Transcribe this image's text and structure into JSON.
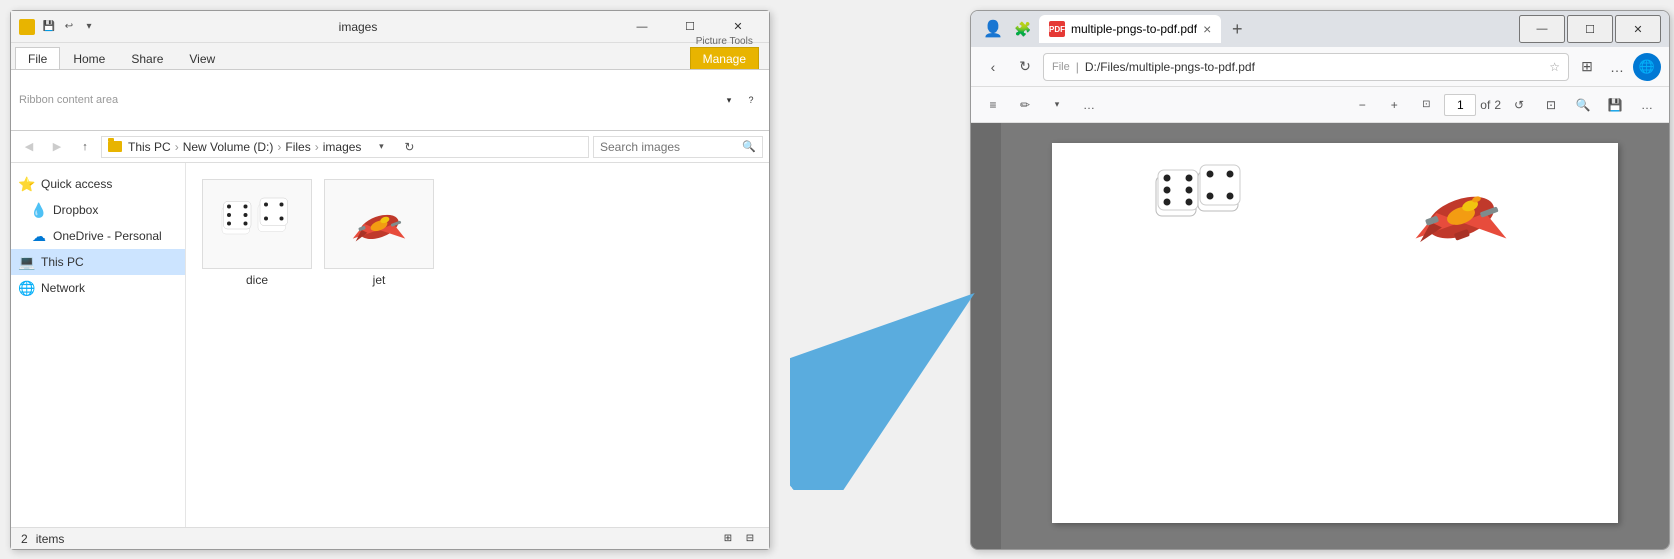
{
  "explorer": {
    "title": "images",
    "title_bar": {
      "app_icon": "folder",
      "qat": [
        "save",
        "undo",
        "dropdown"
      ],
      "window_controls": [
        "minimize",
        "maximize",
        "close"
      ]
    },
    "ribbon": {
      "tabs": [
        "File",
        "Home",
        "Share",
        "View",
        "Manage"
      ],
      "active_tab": "Manage",
      "picture_tools_label": "Picture Tools"
    },
    "address_bar": {
      "nav_back": "◀",
      "nav_forward": "▶",
      "nav_up": "↑",
      "path": "This PC › New Volume (D:) › Files › images",
      "search_placeholder": "Search images",
      "search_icon": "🔍",
      "refresh_icon": "↻",
      "dropdown_icon": "▾"
    },
    "sidebar": {
      "items": [
        {
          "id": "quick-access",
          "label": "Quick access",
          "icon": "⭐"
        },
        {
          "id": "dropbox",
          "label": "Dropbox",
          "icon": "💧"
        },
        {
          "id": "onedrive",
          "label": "OneDrive - Personal",
          "icon": "☁"
        },
        {
          "id": "this-pc",
          "label": "This PC",
          "icon": "💻",
          "active": true
        },
        {
          "id": "network",
          "label": "Network",
          "icon": "🌐"
        }
      ]
    },
    "files": [
      {
        "name": "dice",
        "type": "image"
      },
      {
        "name": "jet",
        "type": "image"
      }
    ],
    "status_bar": {
      "count": "2",
      "items_label": "items"
    }
  },
  "arrow": {
    "color": "#5aacde",
    "direction": "right"
  },
  "browser": {
    "title_bar": {
      "profile_icon": "👤",
      "extensions_icon": "🧩",
      "window_controls": [
        "minimize",
        "maximize",
        "close"
      ]
    },
    "tab": {
      "icon": "PDF",
      "title": "multiple-pngs-to-pdf.pdf",
      "close": "×"
    },
    "new_tab": "+",
    "toolbar": {
      "back": "‹",
      "refresh": "↻",
      "url_lock": "File",
      "url": "D:/Files/multiple-pngs-to-pdf.pdf",
      "star": "☆",
      "reading": "⊞",
      "more": "…",
      "edge_icon": "🌐",
      "zoom_in": "+",
      "zoom_out": "−",
      "zoom_icon": "⊡"
    },
    "pdf_toolbar": {
      "toc_icon": "≡",
      "draw_icon": "✏",
      "draw_dropdown": "▾",
      "more": "…",
      "zoom_out": "−",
      "zoom_in": "+",
      "fit_icon": "⊡",
      "page_current": "1",
      "page_total": "2",
      "rotate_icon": "↺",
      "print_icon": "⊡",
      "search_icon": "🔍",
      "save_icon": "💾",
      "more2": "…"
    },
    "pdf": {
      "page": 1,
      "total_pages": 2,
      "content": {
        "left_group": "dice_images",
        "right_item": "jet_image"
      }
    }
  }
}
